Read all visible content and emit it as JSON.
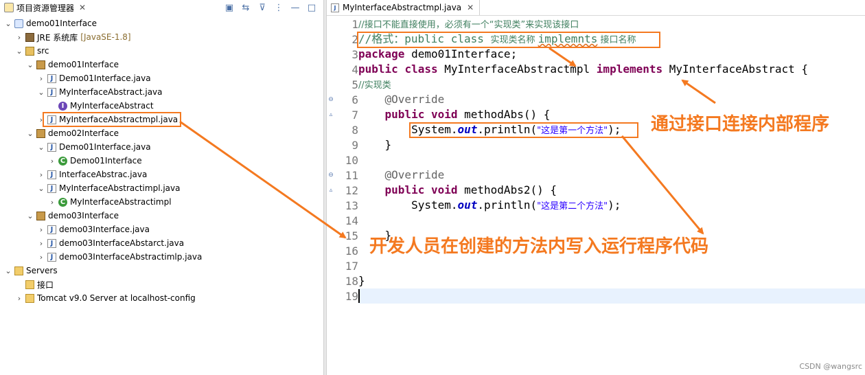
{
  "explorer": {
    "title": "项目资源管理器",
    "close": "✕",
    "tree": [
      {
        "label": "demo01Interface",
        "icon": "project-icon",
        "arrow": "v",
        "indent": 0
      },
      {
        "label": "JRE 系统库",
        "suffix": "[JavaSE-1.8]",
        "icon": "library-icon",
        "arrow": ">",
        "indent": 1
      },
      {
        "label": "src",
        "icon": "source-folder-icon",
        "arrow": "v",
        "indent": 1
      },
      {
        "label": "demo01Interface",
        "icon": "package-icon",
        "arrow": "v",
        "indent": 2
      },
      {
        "label": "Demo01Interface.java",
        "icon": "java-file-icon",
        "arrow": ">",
        "indent": 3
      },
      {
        "label": "MyInterfaceAbstract.java",
        "icon": "java-file-icon",
        "arrow": "v",
        "indent": 3
      },
      {
        "label": "MyInterfaceAbstract",
        "icon": "interface-icon",
        "arrow": "",
        "indent": 4
      },
      {
        "label": "MyInterfaceAbstractmpl.java",
        "icon": "java-file-icon",
        "arrow": ">",
        "indent": 3,
        "highlighted": true
      },
      {
        "label": "demo02Interface",
        "icon": "package-icon",
        "arrow": "v",
        "indent": 2
      },
      {
        "label": "Demo01Interface.java",
        "icon": "java-file-icon",
        "arrow": "v",
        "indent": 3
      },
      {
        "label": "Demo01Interface",
        "icon": "class-icon",
        "arrow": ">",
        "indent": 4
      },
      {
        "label": "InterfaceAbstrac.java",
        "icon": "java-file-icon",
        "arrow": ">",
        "indent": 3
      },
      {
        "label": "MyInterfaceAbstractimpl.java",
        "icon": "java-file-icon",
        "arrow": "v",
        "indent": 3
      },
      {
        "label": "MyInterfaceAbstractimpl",
        "icon": "class-icon",
        "arrow": ">",
        "indent": 4
      },
      {
        "label": "demo03Interface",
        "icon": "package-icon",
        "arrow": "v",
        "indent": 2
      },
      {
        "label": "demo03Interface.java",
        "icon": "java-file-icon",
        "arrow": ">",
        "indent": 3
      },
      {
        "label": "demo03InterfaceAbstarct.java",
        "icon": "java-file-icon",
        "arrow": ">",
        "indent": 3
      },
      {
        "label": "demo03InterfaceAbstractimlp.java",
        "icon": "java-file-icon",
        "arrow": ">",
        "indent": 3
      },
      {
        "label": "Servers",
        "icon": "folder-icon",
        "arrow": "v",
        "indent": 0
      },
      {
        "label": "接口",
        "icon": "folder-icon",
        "arrow": "",
        "indent": 1
      },
      {
        "label": "Tomcat v9.0 Server at localhost-config",
        "icon": "folder-icon",
        "arrow": ">",
        "indent": 1
      }
    ]
  },
  "editor": {
    "tab_label": "MyInterfaceAbstractmpl.java",
    "close": "✕",
    "lines": [
      {
        "n": "1",
        "fold": ""
      },
      {
        "n": "2",
        "fold": ""
      },
      {
        "n": "3",
        "fold": ""
      },
      {
        "n": "4",
        "fold": ""
      },
      {
        "n": "5",
        "fold": ""
      },
      {
        "n": "6",
        "fold": "⊖"
      },
      {
        "n": "7",
        "fold": "▵"
      },
      {
        "n": "8",
        "fold": ""
      },
      {
        "n": "9",
        "fold": ""
      },
      {
        "n": "10",
        "fold": ""
      },
      {
        "n": "11",
        "fold": "⊖"
      },
      {
        "n": "12",
        "fold": "▵"
      },
      {
        "n": "13",
        "fold": ""
      },
      {
        "n": "14",
        "fold": ""
      },
      {
        "n": "15",
        "fold": ""
      },
      {
        "n": "16",
        "fold": ""
      },
      {
        "n": "17",
        "fold": ""
      },
      {
        "n": "18",
        "fold": ""
      },
      {
        "n": "19",
        "fold": ""
      }
    ],
    "code": {
      "l1": "//接口不能直接使用，必须有一个“实现类”来实现该接口",
      "l2a": "//格式：public class ",
      "l2b": "实现类名称 ",
      "l2c": "implemnts",
      "l2d": " 接口名称",
      "l3_kw": "package",
      "l3": " demo01Interface;",
      "l4_kw1": "public",
      "l4_kw2": "class",
      "l4_name": " MyInterfaceAbstractmpl ",
      "l4_kw3": "implements",
      "l4_iface": " MyInterfaceAbstract {",
      "l5": "//实现类",
      "l6": "@Override",
      "l7_kw1": "public",
      "l7_kw2": "void",
      "l7": " methodAbs() {",
      "l8a": "System.",
      "l8b": "out",
      "l8c": ".println(",
      "l8d": "\"这是第一个方法\"",
      "l8e": ");",
      "l9": "}",
      "l11": "@Override",
      "l12_kw1": "public",
      "l12_kw2": "void",
      "l12": " methodAbs2() {",
      "l13a": "System.",
      "l13b": "out",
      "l13c": ".println(",
      "l13d": "\"这是第二个方法\"",
      "l13e": ");",
      "l15": "}",
      "l18": "}"
    }
  },
  "annotations": {
    "a1": "通过接口连接内部程序",
    "a2": "开发人员在创建的方法内写入运行程序代码"
  },
  "watermark": "CSDN @wangsrc",
  "colors": {
    "accent": "#f47920",
    "keyword": "#7f0055",
    "comment": "#3f7f5f",
    "string": "#2a00ff"
  }
}
